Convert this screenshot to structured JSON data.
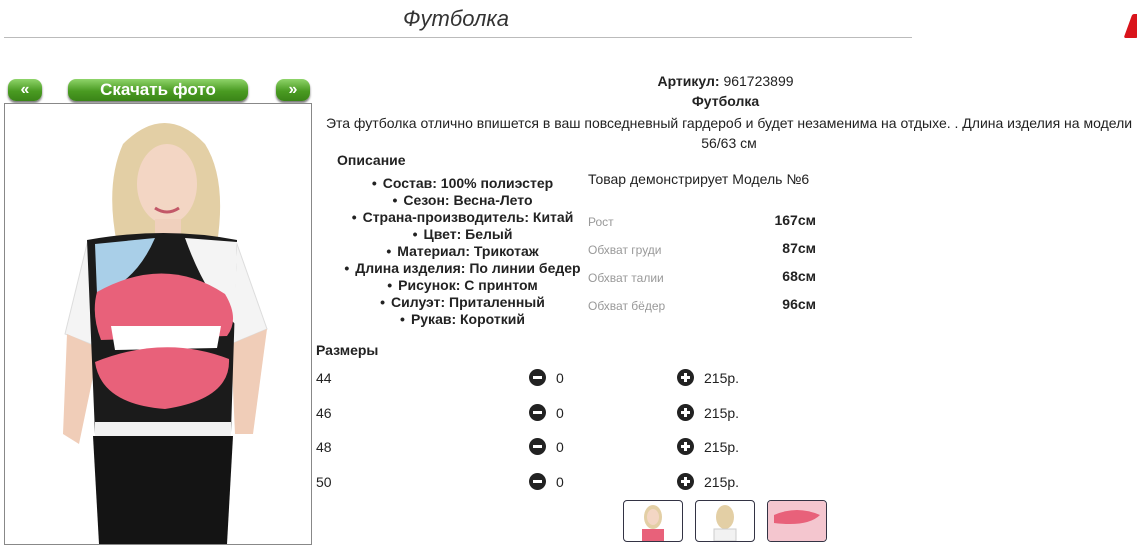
{
  "page": {
    "title": "Футболка"
  },
  "gallery": {
    "prev_label": "«",
    "download_label": "Скачать фото",
    "next_label": "»"
  },
  "product": {
    "article_label": "Артикул:",
    "article_value": "961723899",
    "name": "Футболка",
    "description": "Эта футболка отлично впишется в ваш повседневный гардероб и будет незаменима на отдыхе. . Длина изделия на модели 56/63 см"
  },
  "description_section": {
    "title": "Описание",
    "items": [
      "Состав: 100% полиэстер",
      "Сезон: Весна-Лето",
      "Страна-производитель: Китай",
      "Цвет: Белый",
      "Материал: Трикотаж",
      "Длина изделия: По линии бедер",
      "Рисунок: С принтом",
      "Силуэт: Приталенный",
      "Рукав: Короткий"
    ]
  },
  "model": {
    "demo_text": "Товар демонстрирует Модель №6",
    "measurements": [
      {
        "label": "Рост",
        "value": "167см"
      },
      {
        "label": "Обхват груди",
        "value": "87см"
      },
      {
        "label": "Обхват талии",
        "value": "68см"
      },
      {
        "label": "Обхват бёдер",
        "value": "96см"
      }
    ]
  },
  "sizes": {
    "title": "Размеры",
    "rows": [
      {
        "size": "44",
        "qty": "0",
        "price": "215р."
      },
      {
        "size": "46",
        "qty": "0",
        "price": "215р."
      },
      {
        "size": "48",
        "qty": "0",
        "price": "215р."
      },
      {
        "size": "50",
        "qty": "0",
        "price": "215р."
      }
    ]
  },
  "colors": {
    "button_green": "#4a9b22",
    "lips_pink": "#e8617a",
    "accent_red": "#d9141b"
  },
  "icons": {
    "minus": "minus-circle-icon",
    "plus": "plus-circle-icon"
  }
}
